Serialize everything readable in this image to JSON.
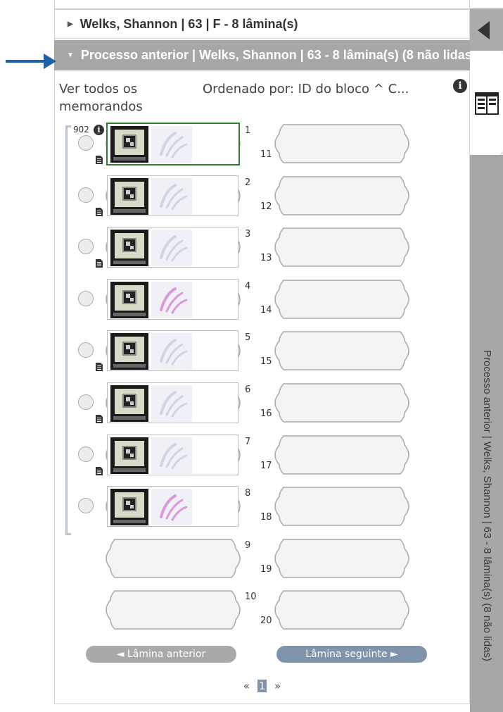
{
  "panel": {
    "collapsed_header": "Welks, Shannon | 63 | F - 8 lâmina(s)",
    "expanded_header": "Processo anterior | Welks, Shannon | 63 - 8 lâmina(s) (8 não lidas)",
    "side_label": "Processo anterior | Welks, Shannon | 63 - 8 lâmina(s) (8 não lidas)"
  },
  "toolbar": {
    "view_all_memos": "Ver todos os memorandos",
    "sort_label": "Ordenado por:  ID do bloco ^ C..."
  },
  "block": {
    "id": "902"
  },
  "slides": [
    {
      "slot": "1",
      "has_memo": true,
      "stain": "light",
      "selected": true
    },
    {
      "slot": "2",
      "has_memo": true,
      "stain": "light",
      "selected": false
    },
    {
      "slot": "3",
      "has_memo": true,
      "stain": "light",
      "selected": false
    },
    {
      "slot": "4",
      "has_memo": false,
      "stain": "pink",
      "selected": false
    },
    {
      "slot": "5",
      "has_memo": true,
      "stain": "light",
      "selected": false
    },
    {
      "slot": "6",
      "has_memo": true,
      "stain": "light",
      "selected": false
    },
    {
      "slot": "7",
      "has_memo": true,
      "stain": "light",
      "selected": false
    },
    {
      "slot": "8",
      "has_memo": false,
      "stain": "pink",
      "selected": false
    }
  ],
  "empty_slots_left": [
    "9",
    "10"
  ],
  "slots_right": [
    "11",
    "12",
    "13",
    "14",
    "15",
    "16",
    "17",
    "18",
    "19",
    "20"
  ],
  "nav": {
    "prev_label": "◄  Lâmina anterior",
    "next_label": "Lâmina seguinte  ►"
  },
  "pager": {
    "prev": "«",
    "current": "1",
    "next": "»"
  },
  "colors": {
    "selected_border": "#2e7d32",
    "arrow": "#1f5fa8",
    "next_button": "#7f93aa"
  }
}
